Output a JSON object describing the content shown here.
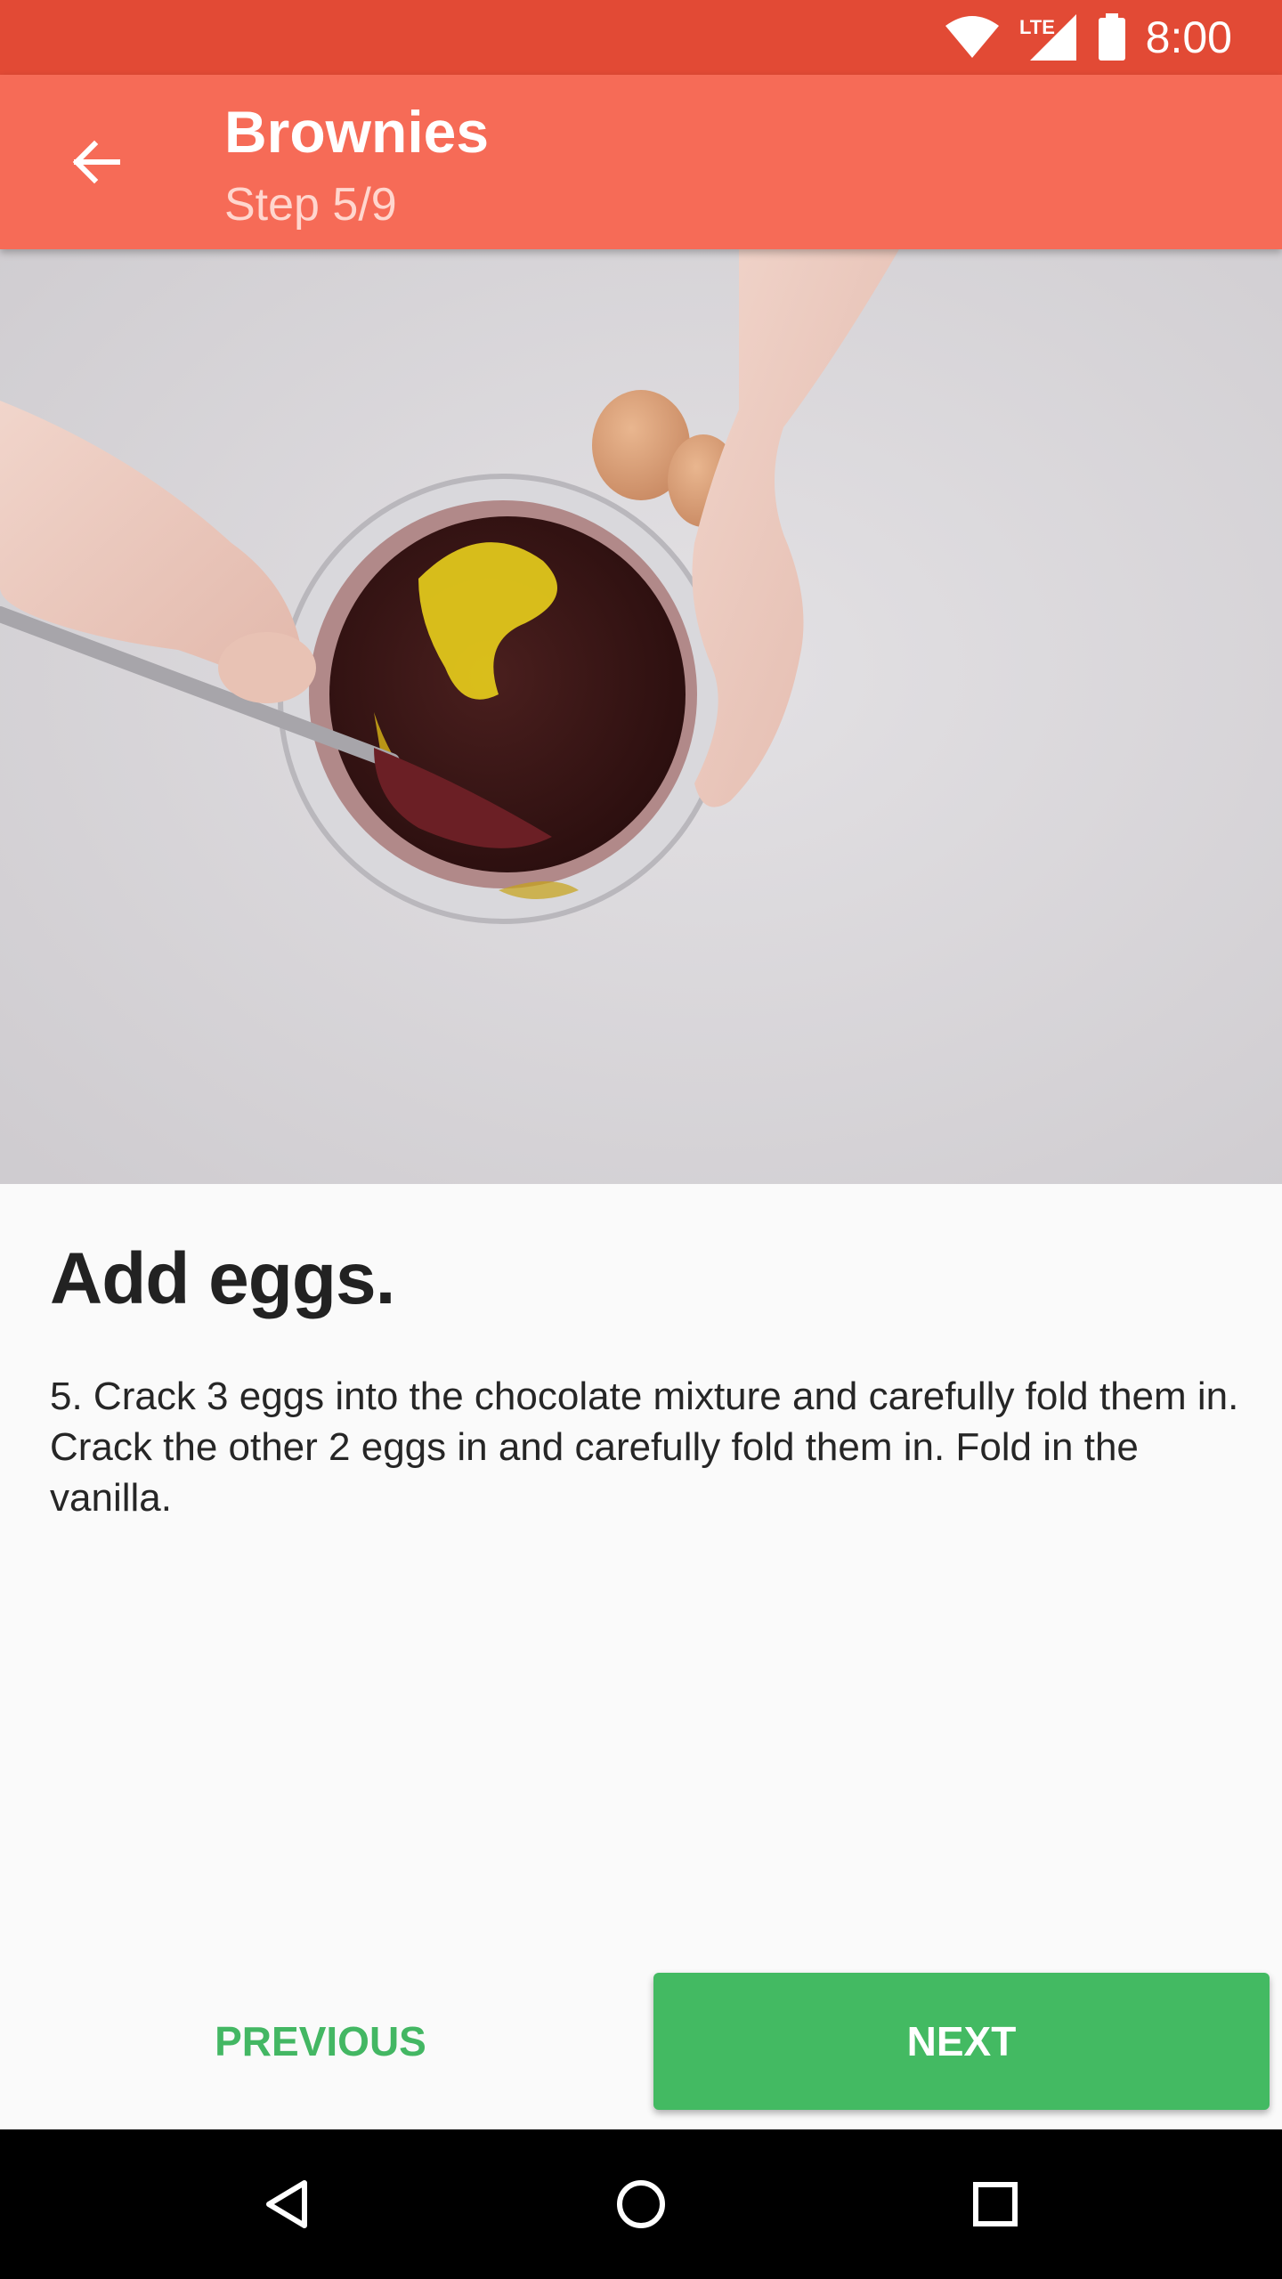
{
  "status_bar": {
    "time": "8:00",
    "network_label": "LTE",
    "icons": [
      "wifi-icon",
      "cell-signal-icon",
      "battery-icon"
    ]
  },
  "app_bar": {
    "title": "Brownies",
    "subtitle": "Step 5/9",
    "back_icon": "arrow-back-icon"
  },
  "step": {
    "heading": "Add eggs.",
    "body": "5. Crack 3 eggs into the chocolate mixture and carefully fold them in. Crack the other 2 eggs in and carefully fold them in. Fold in the vanilla."
  },
  "actions": {
    "previous_label": "PREVIOUS",
    "next_label": "NEXT"
  },
  "nav_bar": {
    "icons": [
      "back-triangle-icon",
      "home-circle-icon",
      "recents-square-icon"
    ]
  },
  "colors": {
    "status_bar": "#e24a35",
    "app_bar": "#f66b57",
    "accent_green": "#43ba62",
    "background": "#fafafa"
  }
}
